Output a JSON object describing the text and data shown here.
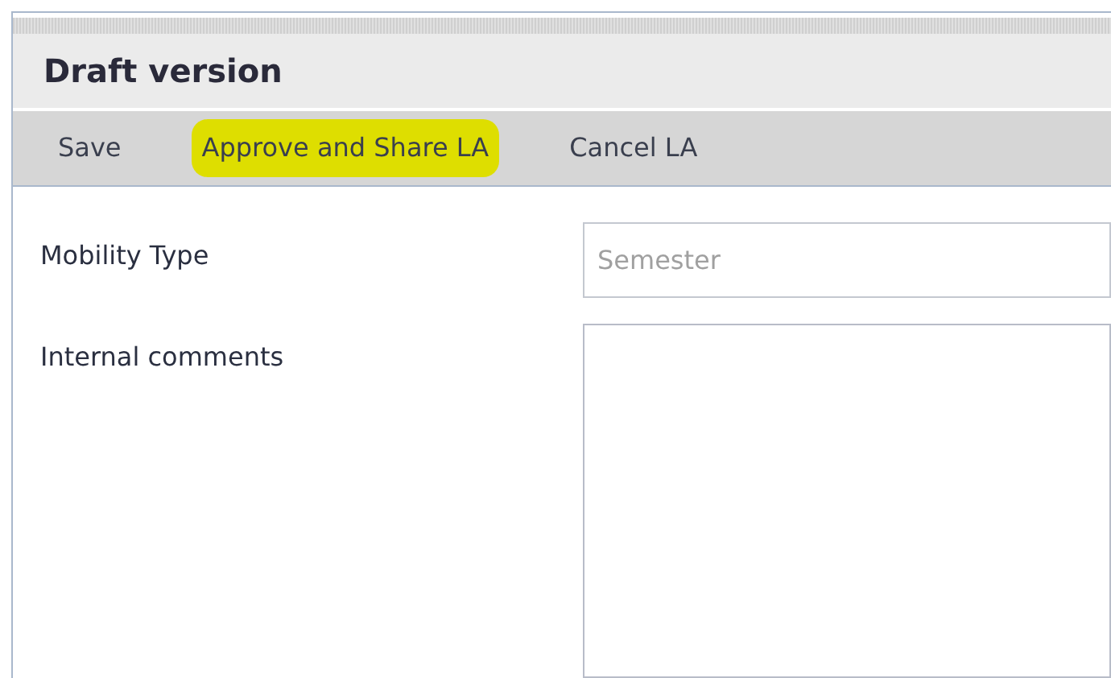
{
  "panel": {
    "title": "Draft version"
  },
  "toolbar": [
    {
      "label": "Save",
      "highlighted": false
    },
    {
      "label": "Approve and Share LA",
      "highlighted": true
    },
    {
      "label": "Cancel LA",
      "highlighted": false
    }
  ],
  "form": [
    {
      "kind": "input",
      "label": "Mobility Type",
      "value": "Semester",
      "disabled": true
    },
    {
      "kind": "textarea",
      "label": "Internal comments"
    }
  ]
}
